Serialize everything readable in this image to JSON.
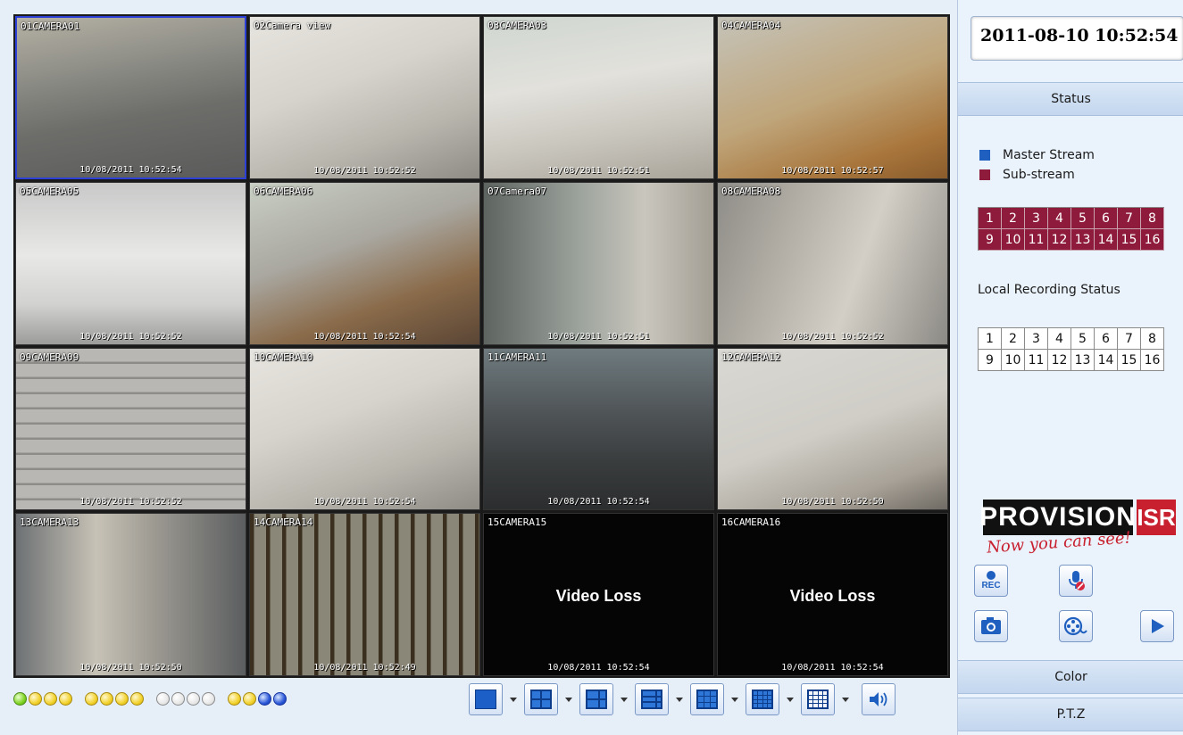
{
  "cameras": [
    {
      "label": "01CAMERA01",
      "timestamp": "10/08/2011 10:52:54",
      "scene": "s-parking",
      "selected": true
    },
    {
      "label": "02Camera view",
      "timestamp": "10/08/2011 10:52:52",
      "scene": "s-office"
    },
    {
      "label": "03CAMERA03",
      "timestamp": "10/08/2011 10:52:51",
      "scene": "s-lobby"
    },
    {
      "label": "04CAMERA04",
      "timestamp": "10/08/2011 10:52:57",
      "scene": "s-reception"
    },
    {
      "label": "05CAMERA05",
      "timestamp": "10/08/2011 10:52:52",
      "scene": "s-hall"
    },
    {
      "label": "06CAMERA06",
      "timestamp": "10/08/2011 10:52:54",
      "scene": "s-meeting"
    },
    {
      "label": "07Camera07",
      "timestamp": "10/08/2011 10:52:51",
      "scene": "s-door"
    },
    {
      "label": "08CAMERA08",
      "timestamp": "10/08/2011 10:52:52",
      "scene": "s-corridor"
    },
    {
      "label": "09CAMERA09",
      "timestamp": "10/08/2011 10:52:52",
      "scene": "s-warehouse"
    },
    {
      "label": "10CAMERA10",
      "timestamp": "10/08/2011 10:52:54",
      "scene": "s-office"
    },
    {
      "label": "11CAMERA11",
      "timestamp": "10/08/2011 10:52:54",
      "scene": "s-garage"
    },
    {
      "label": "12CAMERA12",
      "timestamp": "10/08/2011 10:52:50",
      "scene": "s-office2"
    },
    {
      "label": "13CAMERA13",
      "timestamp": "10/08/2011 10:52:50",
      "scene": "s-room"
    },
    {
      "label": "14CAMERA14",
      "timestamp": "10/08/2011 10:52:49",
      "scene": "s-gate"
    },
    {
      "label": "15CAMERA15",
      "timestamp": "10/08/2011 10:52:54",
      "scene": "black",
      "loss": "Video Loss"
    },
    {
      "label": "16CAMERA16",
      "timestamp": "10/08/2011 10:52:54",
      "scene": "black",
      "loss": "Video Loss"
    }
  ],
  "channel_status": [
    [
      "green",
      "yellow",
      "yellow",
      "yellow"
    ],
    [
      "yellow",
      "yellow",
      "yellow",
      "yellow"
    ],
    [
      "white",
      "white",
      "white",
      "white"
    ],
    [
      "yellow",
      "yellow",
      "blue",
      "blue"
    ]
  ],
  "layouts": [
    "one",
    "four",
    "six",
    "eight",
    "nine",
    "thirteen",
    "sixteen"
  ],
  "panel": {
    "datetime": "2011-08-10 10:52:54",
    "status_label": "Status",
    "legend": {
      "master": "Master Stream",
      "sub": "Sub-stream"
    },
    "stream_channels": [
      "1",
      "2",
      "3",
      "4",
      "5",
      "6",
      "7",
      "8",
      "9",
      "10",
      "11",
      "12",
      "13",
      "14",
      "15",
      "16"
    ],
    "local_recording_title": "Local Recording Status",
    "rec_channels": [
      "1",
      "2",
      "3",
      "4",
      "5",
      "6",
      "7",
      "8",
      "9",
      "10",
      "11",
      "12",
      "13",
      "14",
      "15",
      "16"
    ],
    "color_label": "Color",
    "ptz_label": "P.T.Z",
    "rec_label": "REC"
  },
  "logo": {
    "brand": "PROVISION",
    "isr": "ISR",
    "tagline": "Now you can see!"
  },
  "colors": {
    "master": "#1f5fbf",
    "sub": "#8e1b3b",
    "selected_border": "#2c3fd6"
  },
  "icons": [
    "audio-icon",
    "microphone-icon",
    "camera-icon",
    "film-reel-icon",
    "play-icon"
  ]
}
